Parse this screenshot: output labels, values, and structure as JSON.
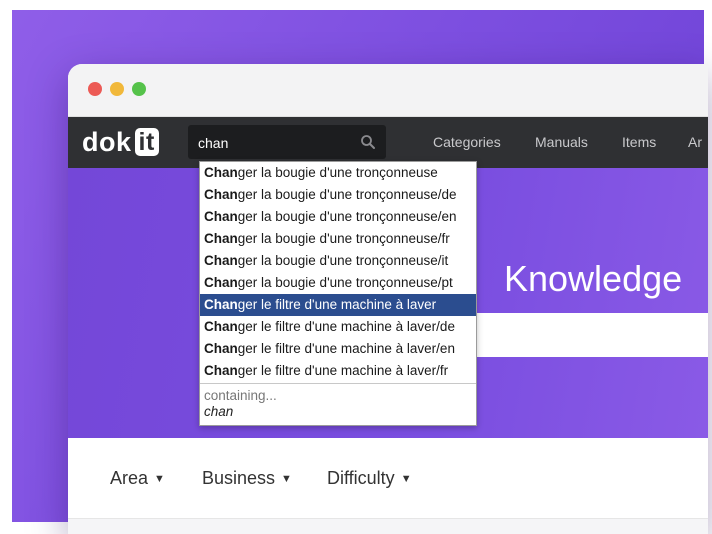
{
  "window": {
    "controls": [
      "close",
      "minimize",
      "maximize"
    ]
  },
  "navbar": {
    "logo_text": "dok",
    "logo_box_text": "it",
    "search": {
      "value": "chan",
      "icon": "search-icon"
    },
    "links": [
      "Categories",
      "Manuals",
      "Items",
      "Ar"
    ]
  },
  "hero": {
    "title": "Knowledge"
  },
  "filters": [
    "Area",
    "Business",
    "Difficulty"
  ],
  "autocomplete": {
    "suggestions": [
      {
        "bold": "Chan",
        "rest": "ger la bougie d'une tronçonneuse"
      },
      {
        "bold": "Chan",
        "rest": "ger la bougie d'une tronçonneuse/de"
      },
      {
        "bold": "Chan",
        "rest": "ger la bougie d'une tronçonneuse/en"
      },
      {
        "bold": "Chan",
        "rest": "ger la bougie d'une tronçonneuse/fr"
      },
      {
        "bold": "Chan",
        "rest": "ger la bougie d'une tronçonneuse/it"
      },
      {
        "bold": "Chan",
        "rest": "ger la bougie d'une tronçonneuse/pt"
      },
      {
        "bold": "Chan",
        "rest": "ger le filtre d'une machine à laver"
      },
      {
        "bold": "Chan",
        "rest": "ger le filtre d'une machine à laver/de"
      },
      {
        "bold": "Chan",
        "rest": "ger le filtre d'une machine à laver/en"
      },
      {
        "bold": "Chan",
        "rest": "ger le filtre d'une machine à laver/fr"
      }
    ],
    "active_index": 6,
    "containing_label": "containing...",
    "containing_query": "chan"
  },
  "colors": {
    "background_purple": "#7d4fe0",
    "navbar": "#2f3033",
    "highlight": "#2b4d8f"
  }
}
